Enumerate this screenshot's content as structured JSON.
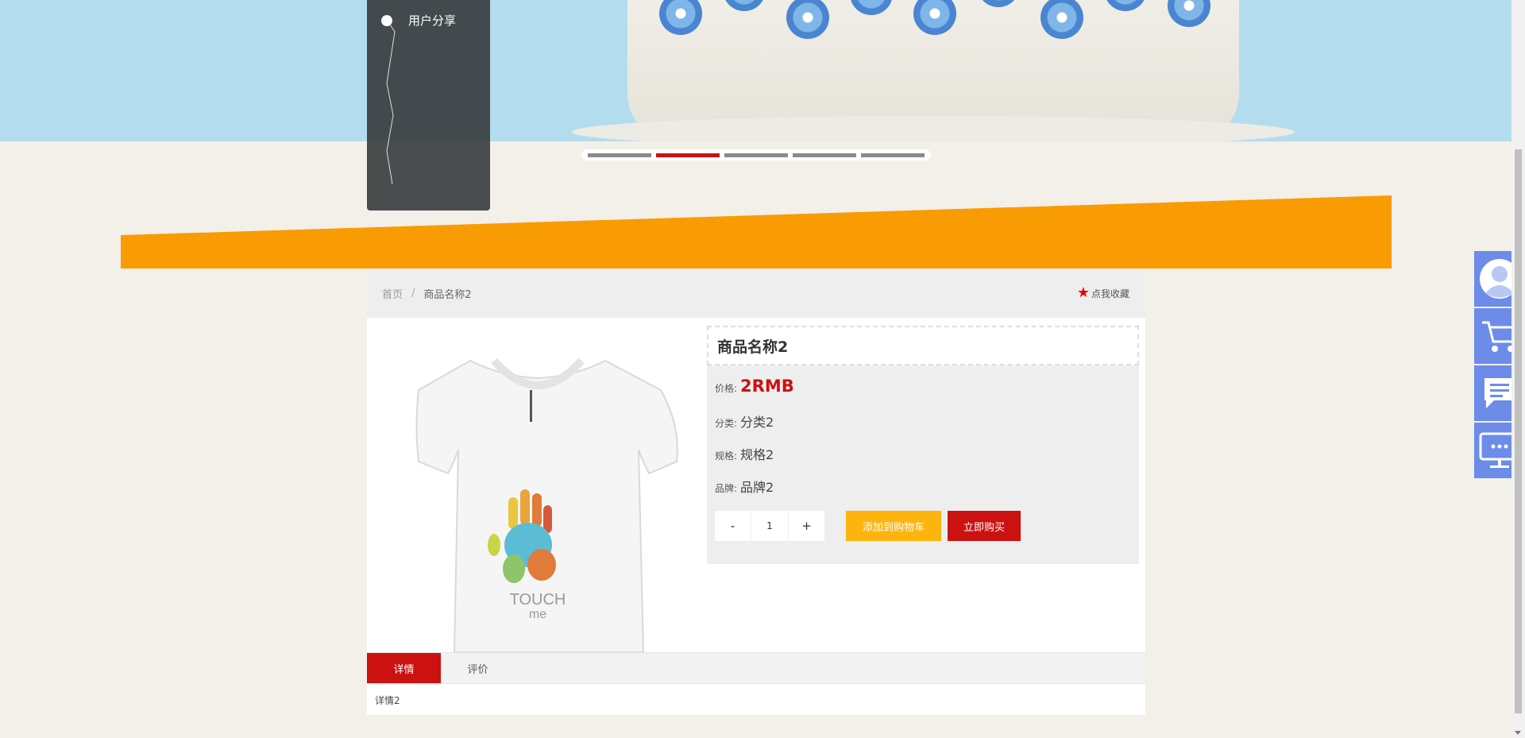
{
  "nav": {
    "items": [
      {
        "label": "用户分享"
      }
    ]
  },
  "carousel": {
    "slide_count": 5,
    "active_index": 1
  },
  "breadcrumb": {
    "home": "首页",
    "separator": "/",
    "current": "商品名称2"
  },
  "favorite": {
    "label": "点我收藏"
  },
  "product": {
    "name": "商品名称2",
    "price_label": "价格:",
    "price": "2RMB",
    "category_label": "分类:",
    "category": "分类2",
    "spec_label": "规格:",
    "spec": "规格2",
    "brand_label": "品牌:",
    "brand": "品牌2",
    "image_text": "TOUCH me"
  },
  "quantity": {
    "minus": "-",
    "value": "1",
    "plus": "+"
  },
  "actions": {
    "add_to_cart": "添加到购物车",
    "buy_now": "立即购买"
  },
  "tabs": [
    {
      "label": "详情"
    },
    {
      "label": "评价"
    }
  ],
  "tab_content": "详情2",
  "colors": {
    "accent": "#cc1111",
    "orange": "#f99b03",
    "cart_button": "#fdb40d",
    "sidebar": "#6d8cea"
  },
  "sidebar_icons": [
    "user-icon",
    "cart-icon",
    "message-icon",
    "monitor-chat-icon"
  ]
}
